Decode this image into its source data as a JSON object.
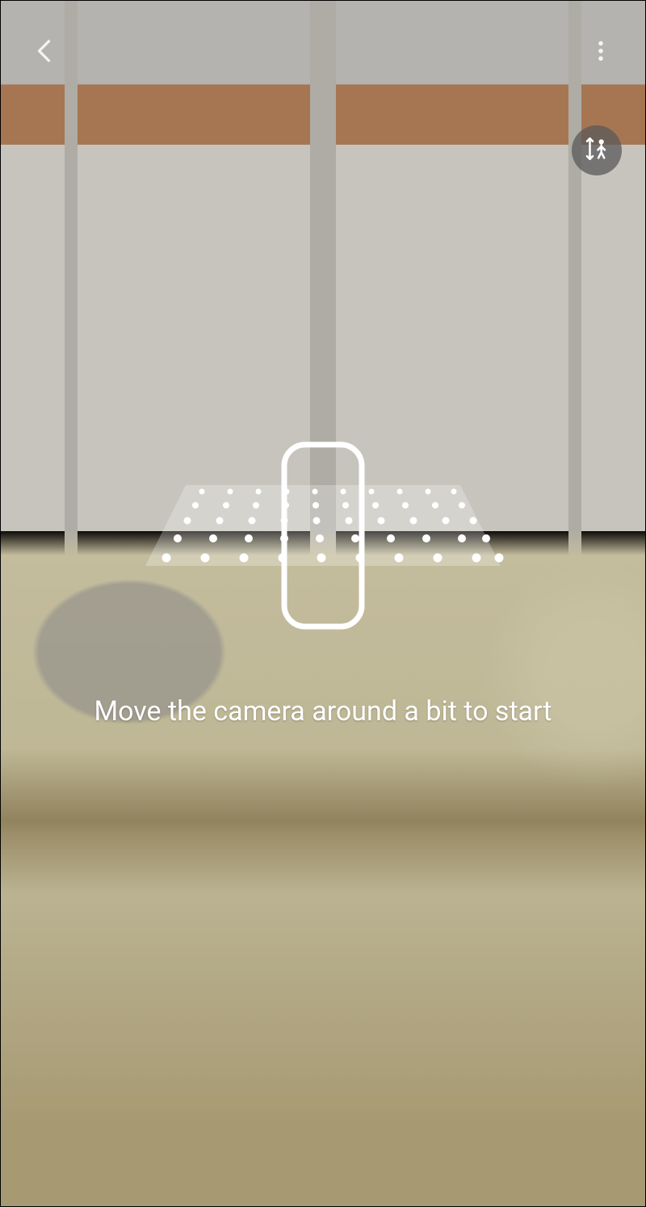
{
  "instruction_text": "Move the camera around a bit to start",
  "icons": {
    "back": "back-chevron-icon",
    "more": "more-vert-icon",
    "measure_person": "measure-height-icon",
    "ar_plane": "ar-plane-animation"
  },
  "colors": {
    "overlay_tint": "rgba(60,50,35,0.22)",
    "text": "#ffffff",
    "round_button_bg": "rgba(90,90,90,0.75)"
  }
}
